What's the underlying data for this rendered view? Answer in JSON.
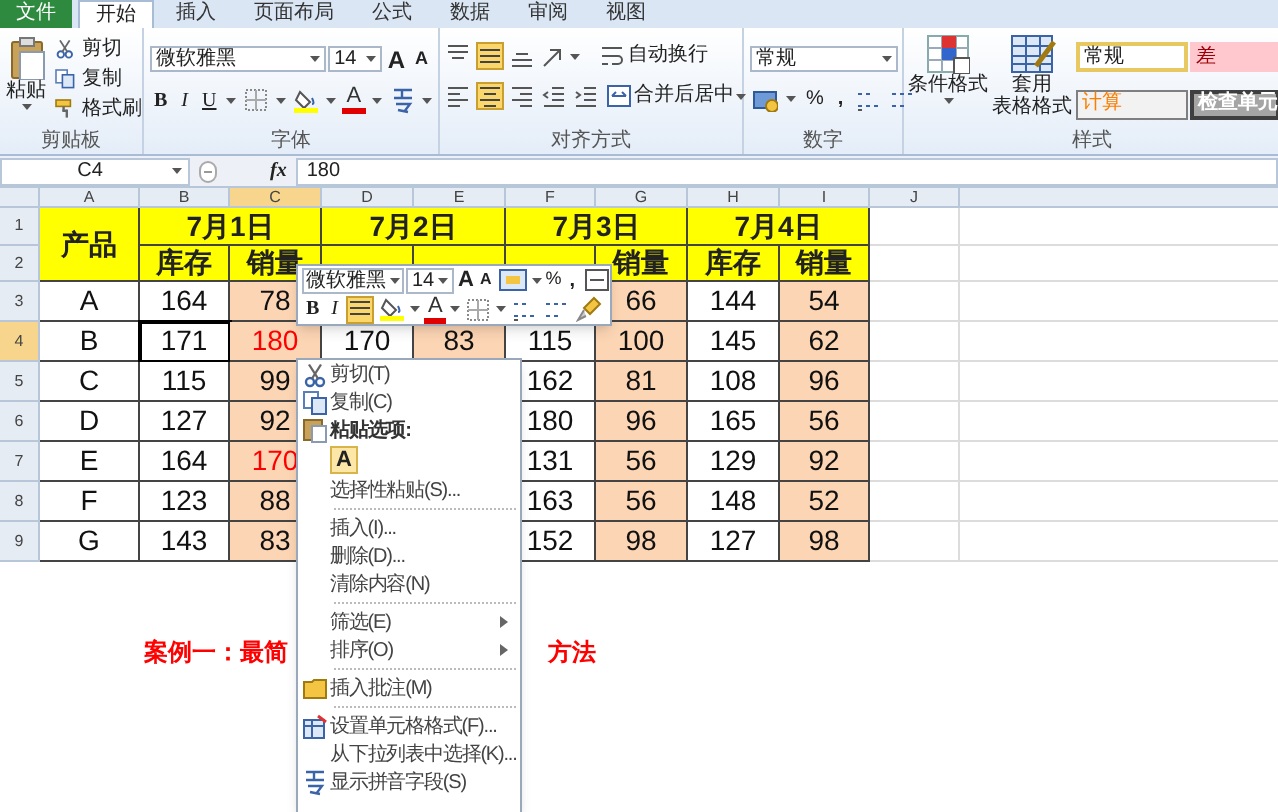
{
  "tabs": [
    {
      "label": "文件",
      "kind": "file",
      "selected": false
    },
    {
      "label": "开始",
      "kind": "tab",
      "selected": true
    },
    {
      "label": "插入",
      "kind": "tab",
      "selected": false
    },
    {
      "label": "页面布局",
      "kind": "tab",
      "selected": false
    },
    {
      "label": "公式",
      "kind": "tab",
      "selected": false
    },
    {
      "label": "数据",
      "kind": "tab",
      "selected": false
    },
    {
      "label": "审阅",
      "kind": "tab",
      "selected": false
    },
    {
      "label": "视图",
      "kind": "tab",
      "selected": false
    }
  ],
  "ribbon": {
    "clipboard": {
      "paste": "粘贴",
      "cut": "剪切",
      "copy": "复制",
      "format_painter": "格式刷",
      "label": "剪贴板"
    },
    "font": {
      "family": "微软雅黑",
      "size": "14",
      "grow": "A",
      "shrink": "A",
      "bold": "B",
      "italic": "I",
      "underline": "U",
      "font_color": "A",
      "label": "字体"
    },
    "alignment": {
      "vertical": [
        {
          "selected": false
        },
        {
          "selected": true
        },
        {
          "selected": false
        }
      ],
      "horizontal": [
        {
          "selected": false
        },
        {
          "selected": true
        },
        {
          "selected": false
        }
      ],
      "wrap": "自动换行",
      "merge": "合并后居中",
      "label": "对齐方式"
    },
    "number": {
      "format": "常规",
      "percent": "%",
      "comma": ",",
      "label": "数字"
    },
    "styles": {
      "conditional": "条件格式",
      "table_format_1": "套用",
      "table_format_2": "表格格式",
      "cells": [
        "常规",
        "差",
        "计算",
        "检查单元"
      ],
      "label": "样式"
    }
  },
  "formula_bar": {
    "name_box": "C4",
    "function_label": "fx",
    "formula": "180"
  },
  "sheet": {
    "columns": [
      {
        "label": "A",
        "selected": false
      },
      {
        "label": "B",
        "selected": false
      },
      {
        "label": "C",
        "selected": true
      },
      {
        "label": "D",
        "selected": false
      },
      {
        "label": "E",
        "selected": false
      },
      {
        "label": "F",
        "selected": false
      },
      {
        "label": "G",
        "selected": false
      },
      {
        "label": "H",
        "selected": false
      },
      {
        "label": "I",
        "selected": false
      },
      {
        "label": "J",
        "selected": false
      }
    ],
    "row_headers": [
      {
        "label": "1",
        "selected": false
      },
      {
        "label": "2",
        "selected": false
      },
      {
        "label": "3",
        "selected": false
      },
      {
        "label": "4",
        "selected": true
      },
      {
        "label": "5",
        "selected": false
      },
      {
        "label": "6",
        "selected": false
      },
      {
        "label": "7",
        "selected": false
      },
      {
        "label": "8",
        "selected": false
      },
      {
        "label": "9",
        "selected": false
      }
    ],
    "product_header": "产品",
    "dates": [
      {
        "label": "7月1日",
        "stock": "库存",
        "sales": "销量"
      },
      {
        "label": "7月2日"
      },
      {
        "label": "7月3日",
        "sales": "销量"
      },
      {
        "label": "7月4日",
        "stock": "库存",
        "sales": "销量"
      }
    ],
    "rows": [
      [
        {
          "text": "A",
          "red": false
        },
        {
          "text": "164",
          "red": false
        },
        {
          "text": "78",
          "red": false
        },
        null,
        null,
        null,
        {
          "text": "66",
          "red": false
        },
        {
          "text": "144",
          "red": false
        },
        {
          "text": "54",
          "red": false
        }
      ],
      [
        {
          "text": "B",
          "red": false
        },
        {
          "text": "171",
          "red": false
        },
        {
          "text": "180",
          "red": true
        },
        {
          "text": "170",
          "red": false
        },
        {
          "text": "83",
          "red": false
        },
        {
          "text": "115",
          "red": false
        },
        {
          "text": "100",
          "red": false
        },
        {
          "text": "145",
          "red": false
        },
        {
          "text": "62",
          "red": false
        }
      ],
      [
        {
          "text": "C",
          "red": false
        },
        {
          "text": "115",
          "red": false
        },
        {
          "text": "99",
          "red": false
        },
        null,
        null,
        {
          "text": "162",
          "red": false
        },
        {
          "text": "81",
          "red": false
        },
        {
          "text": "108",
          "red": false
        },
        {
          "text": "96",
          "red": false
        }
      ],
      [
        {
          "text": "D",
          "red": false
        },
        {
          "text": "127",
          "red": false
        },
        {
          "text": "92",
          "red": false
        },
        null,
        null,
        {
          "text": "180",
          "red": false
        },
        {
          "text": "96",
          "red": false
        },
        {
          "text": "165",
          "red": false
        },
        {
          "text": "56",
          "red": false
        }
      ],
      [
        {
          "text": "E",
          "red": false
        },
        {
          "text": "164",
          "red": false
        },
        {
          "text": "170",
          "red": true
        },
        null,
        null,
        {
          "text": "131",
          "red": false
        },
        {
          "text": "56",
          "red": false
        },
        {
          "text": "129",
          "red": false
        },
        {
          "text": "92",
          "red": false
        }
      ],
      [
        {
          "text": "F",
          "red": false
        },
        {
          "text": "123",
          "red": false
        },
        {
          "text": "88",
          "red": false
        },
        null,
        null,
        {
          "text": "163",
          "red": false
        },
        {
          "text": "56",
          "red": false
        },
        {
          "text": "148",
          "red": false
        },
        {
          "text": "52",
          "red": false
        }
      ],
      [
        {
          "text": "G",
          "red": false
        },
        {
          "text": "143",
          "red": false
        },
        {
          "text": "83",
          "red": false
        },
        null,
        null,
        {
          "text": "152",
          "red": false
        },
        {
          "text": "98",
          "red": false
        },
        {
          "text": "127",
          "red": false
        },
        {
          "text": "98",
          "red": false
        }
      ]
    ],
    "caption_left": "案例一：最简",
    "caption_right": "方法"
  },
  "mini_toolbar": {
    "font": "微软雅黑",
    "size": "14",
    "grow": "A",
    "shrink": "A",
    "percent": "%",
    "comma": ",",
    "bold": "B",
    "italic": "I",
    "center": {
      "selected": true
    },
    "font_color": "A"
  },
  "context_menu": [
    {
      "label": "剪切(T)",
      "kind": "cut"
    },
    {
      "label": "复制(C)",
      "kind": "copy"
    },
    {
      "label": "粘贴选项:",
      "kind": "paste"
    },
    {
      "label": "A",
      "kind": "paste_option"
    },
    {
      "label": "选择性粘贴(S)...",
      "kind": "item"
    },
    {
      "label": "插入(I)...",
      "kind": "item",
      "separator_before": true
    },
    {
      "label": "删除(D)...",
      "kind": "item"
    },
    {
      "label": "清除内容(N)",
      "kind": "item"
    },
    {
      "label": "筛选(E)",
      "kind": "submenu",
      "separator_before": true
    },
    {
      "label": "排序(O)",
      "kind": "submenu"
    },
    {
      "label": "插入批注(M)",
      "kind": "comment",
      "separator_before": true
    },
    {
      "label": "设置单元格格式(F)...",
      "kind": "format",
      "separator_before": true
    },
    {
      "label": "从下拉列表中选择(K)...",
      "kind": "item"
    },
    {
      "label": "显示拼音字段(S)",
      "kind": "pinyin"
    }
  ]
}
